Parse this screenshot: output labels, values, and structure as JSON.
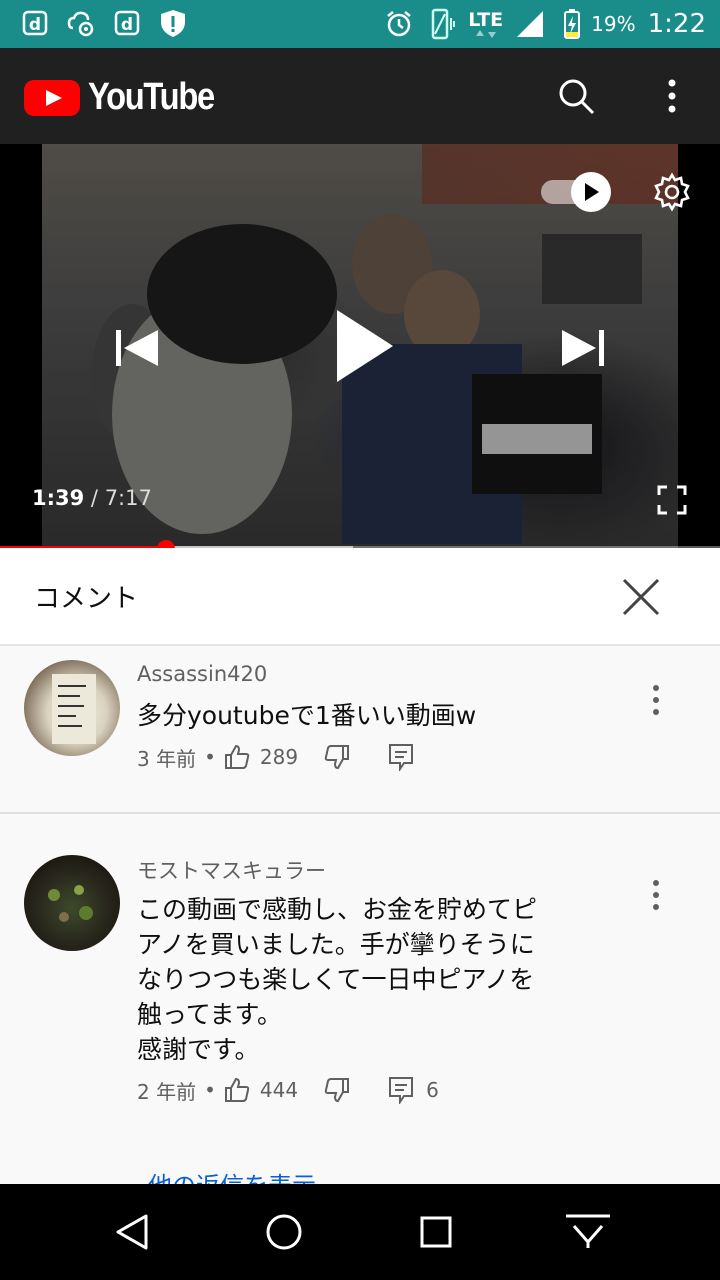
{
  "status_bar": {
    "network": "LTE",
    "battery": "19%",
    "time": "1:22",
    "left_icons": [
      "docomo-d-icon",
      "cloud-settings-icon",
      "docomo-d-icon",
      "shield-alert-icon"
    ]
  },
  "app_bar": {
    "logo_text": "YouTube",
    "icons": [
      "search-icon",
      "more-vert-icon"
    ]
  },
  "player": {
    "current_time": "1:39",
    "separator": "/",
    "duration": "7:17",
    "progress_fraction": 0.23,
    "buffered_fraction": 0.49,
    "autoplay": true,
    "icons": [
      "autoplay-toggle-icon",
      "settings-gear-icon",
      "previous-icon",
      "play-icon",
      "next-icon",
      "fullscreen-icon"
    ]
  },
  "comments_panel": {
    "title": "コメント",
    "close_icon": "close-icon"
  },
  "comments": [
    {
      "author": "Assassin420",
      "text": "多分youtubeで1番いい動画w",
      "time": "3 年前",
      "dot": "•",
      "likes": "289",
      "replies": ""
    },
    {
      "author": "モストマスキュラー",
      "text": "この動画で感動し、お金を貯めてピ\nアノを買いました。手が攣りそうに\nなりつつも楽しくて一日中ピアノを\n触ってます。\n感謝です。",
      "time": "2 年前",
      "dot": "•",
      "likes": "444",
      "replies": "6",
      "view_replies": "他の返信を表示"
    }
  ],
  "nav_bar": {
    "icons": [
      "back-icon",
      "home-icon",
      "recents-icon",
      "hide-keyboard-icon"
    ]
  },
  "colors": {
    "status_bar": "#1a8d8a",
    "app_bar": "#202020",
    "youtube_red": "#ff0000",
    "link_blue": "#065fd4"
  }
}
